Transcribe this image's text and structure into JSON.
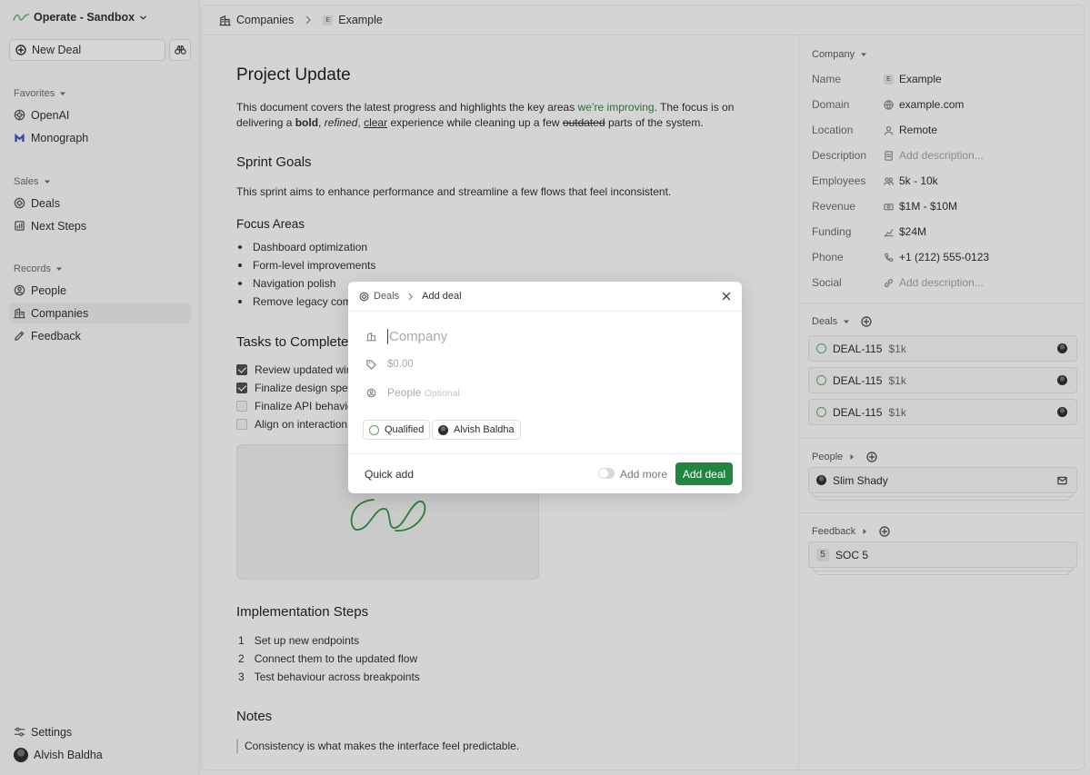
{
  "sidebar": {
    "workspace": "Operate - Sandbox",
    "new_deal": "New Deal",
    "favorites_label": "Favorites",
    "favorites": [
      "OpenAI",
      "Monograph"
    ],
    "sales_label": "Sales",
    "sales": [
      "Deals",
      "Next Steps"
    ],
    "records_label": "Records",
    "records": [
      "People",
      "Companies",
      "Feedback"
    ],
    "settings": "Settings",
    "user": "Alvish Baldha"
  },
  "breadcrumb": {
    "root": "Companies",
    "current": "Example",
    "badge": "E"
  },
  "doc": {
    "title": "Project Update",
    "intro": {
      "p1": "This document covers the latest progress and highlights the key areas ",
      "green": "we’re improving",
      "p2": ". The focus is on delivering a ",
      "bold": "bold",
      "c1": ", ",
      "italic": "refined",
      "c2": ", ",
      "underline": "clear",
      "p3": " experience while cleaning up a few ",
      "strike": "outdated",
      "p4": " parts of the system."
    },
    "sprint_title": "Sprint Goals",
    "sprint_text": "This sprint aims to enhance performance and streamline a few flows that feel inconsistent.",
    "focus_title": "Focus Areas",
    "focus": [
      "Dashboard optimization",
      "Form-level improvements",
      "Navigation polish",
      "Remove legacy comp"
    ],
    "tasks_title": "Tasks to Complete",
    "tasks": [
      {
        "label": "Review updated wire",
        "done": true
      },
      {
        "label": "Finalize design specs",
        "done": true
      },
      {
        "label": "Finalize API behaviou",
        "done": false
      },
      {
        "label": "Align on interaction c",
        "done": false
      }
    ],
    "impl_title": "Implementation Steps",
    "impl": [
      {
        "n": "1",
        "label": "Set up new endpoints"
      },
      {
        "n": "2",
        "label": "Connect them to the updated flow"
      },
      {
        "n": "3",
        "label": "Test behaviour across breakpoints"
      }
    ],
    "notes_title": "Notes",
    "quote": "Consistency is what makes the interface feel predictable."
  },
  "panel": {
    "company_label": "Company",
    "props": [
      {
        "k": "Name",
        "v": "Example",
        "icon": "e-badge-icon"
      },
      {
        "k": "Domain",
        "v": "example.com",
        "icon": "globe-icon"
      },
      {
        "k": "Location",
        "v": "Remote",
        "icon": "person-icon"
      },
      {
        "k": "Description",
        "v": "Add description...",
        "icon": "doc-icon",
        "placeholder": true
      },
      {
        "k": "Employees",
        "v": "5k - 10k",
        "icon": "users-icon"
      },
      {
        "k": "Revenue",
        "v": "$1M - $10M",
        "icon": "cash-icon"
      },
      {
        "k": "Funding",
        "v": "$24M",
        "icon": "chart-icon"
      },
      {
        "k": "Phone",
        "v": "+1 (212) 555-0123",
        "icon": "phone-icon"
      },
      {
        "k": "Social",
        "v": "Add description...",
        "icon": "link-icon",
        "placeholder": true
      }
    ],
    "deals_label": "Deals",
    "deals": [
      {
        "id": "DEAL-115",
        "amount": "$1k"
      },
      {
        "id": "DEAL-115",
        "amount": "$1k"
      },
      {
        "id": "DEAL-115",
        "amount": "$1k"
      }
    ],
    "people_label": "People",
    "person": "Slim Shady",
    "feedback_label": "Feedback",
    "feedback_num": "5",
    "feedback_item": "SOC 5"
  },
  "modal": {
    "crumb_root": "Deals",
    "crumb_current": "Add deal",
    "company_placeholder": "Company",
    "amount_placeholder": "$0.00",
    "people_placeholder": "People",
    "people_hint": "Optional",
    "stage": "Qualified",
    "owner": "Alvish Baldha",
    "quick_add": "Quick add",
    "add_more": "Add more",
    "submit": "Add deal"
  },
  "colors": {
    "accent": "#22873e",
    "ring": "#5f9f6d",
    "link_green": "#2f7d3d"
  }
}
